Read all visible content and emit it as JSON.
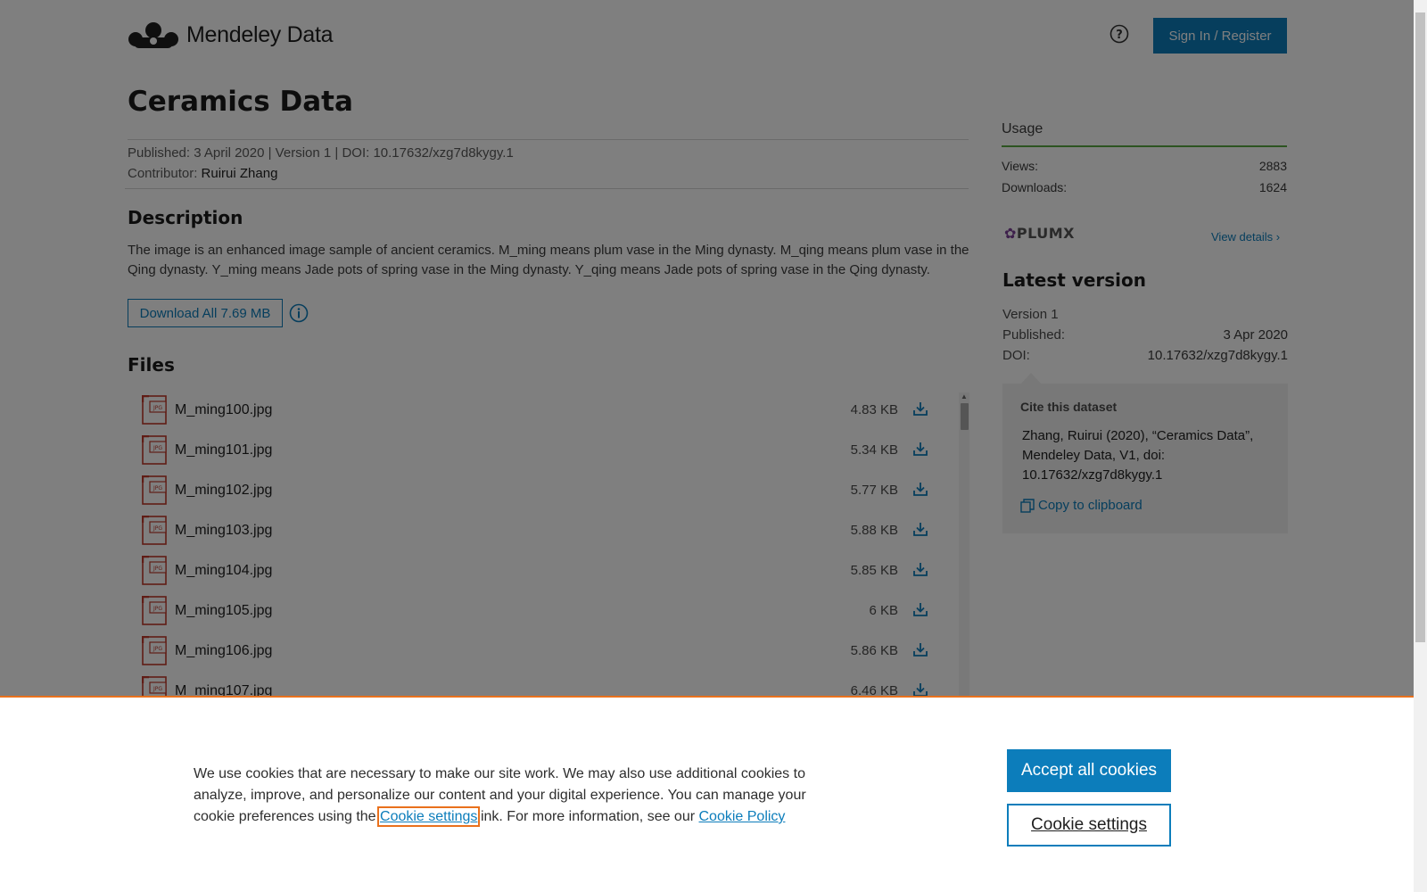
{
  "header": {
    "logo_text": "Mendeley Data",
    "signin_label": "Sign In / Register"
  },
  "dataset": {
    "title": "Ceramics Data",
    "published_line": "Published: 3 April 2020 | Version 1 | DOI: 10.17632/xzg7d8kygy.1",
    "contributor_label": "Contributor:",
    "contributor_name": "Ruirui Zhang",
    "description_heading": "Description",
    "description": "The image is an enhanced image sample of ancient ceramics. M_ming means plum vase in the Ming dynasty. M_qing means plum vase in the Qing dynasty. Y_ming means  Jade pots of spring vase in the Ming dynasty. Y_qing means  Jade pots of spring vase in the Qing dynasty.",
    "download_all_label": "Download All 7.69 MB",
    "files_heading": "Files"
  },
  "files": [
    {
      "name": "M_ming100.jpg",
      "size": "4.83 KB"
    },
    {
      "name": "M_ming101.jpg",
      "size": "5.34 KB"
    },
    {
      "name": "M_ming102.jpg",
      "size": "5.77 KB"
    },
    {
      "name": "M_ming103.jpg",
      "size": "5.88 KB"
    },
    {
      "name": "M_ming104.jpg",
      "size": "5.85 KB"
    },
    {
      "name": "M_ming105.jpg",
      "size": "6 KB"
    },
    {
      "name": "M_ming106.jpg",
      "size": "5.86 KB"
    },
    {
      "name": "M_ming107.jpg",
      "size": "6.46 KB"
    }
  ],
  "usage": {
    "heading": "Usage",
    "views_label": "Views:",
    "views": "2883",
    "downloads_label": "Downloads:",
    "downloads": "1624",
    "plumx": "PLUMX",
    "view_details": "View details"
  },
  "latest": {
    "heading": "Latest version",
    "version": "Version 1",
    "published_label": "Published:",
    "published": "3 Apr 2020",
    "doi_label": "DOI:",
    "doi": "10.17632/xzg7d8kygy.1"
  },
  "cite": {
    "heading": "Cite this dataset",
    "text": "Zhang, Ruirui (2020), “Ceramics Data”, Mendeley Data, V1, doi: 10.17632/xzg7d8kygy.1",
    "copy_label": "Copy to clipboard"
  },
  "cookie": {
    "text_before": "We use cookies that are necessary to make our site work. We may also use additional cookies to analyze, improve, and personalize our content and your digital experience. You can manage your cookie preferences using the ",
    "settings_link": "Cookie settings",
    "text_middle": "link. For more information, see our ",
    "policy_link": "Cookie Policy",
    "accept_label": "Accept all cookies",
    "settings_label": "Cookie settings"
  },
  "colors": {
    "accent": "#0c7dbb",
    "usage_rule": "#5ba843",
    "cookie_border": "#e9711c",
    "file_icon": "#c0392b"
  }
}
